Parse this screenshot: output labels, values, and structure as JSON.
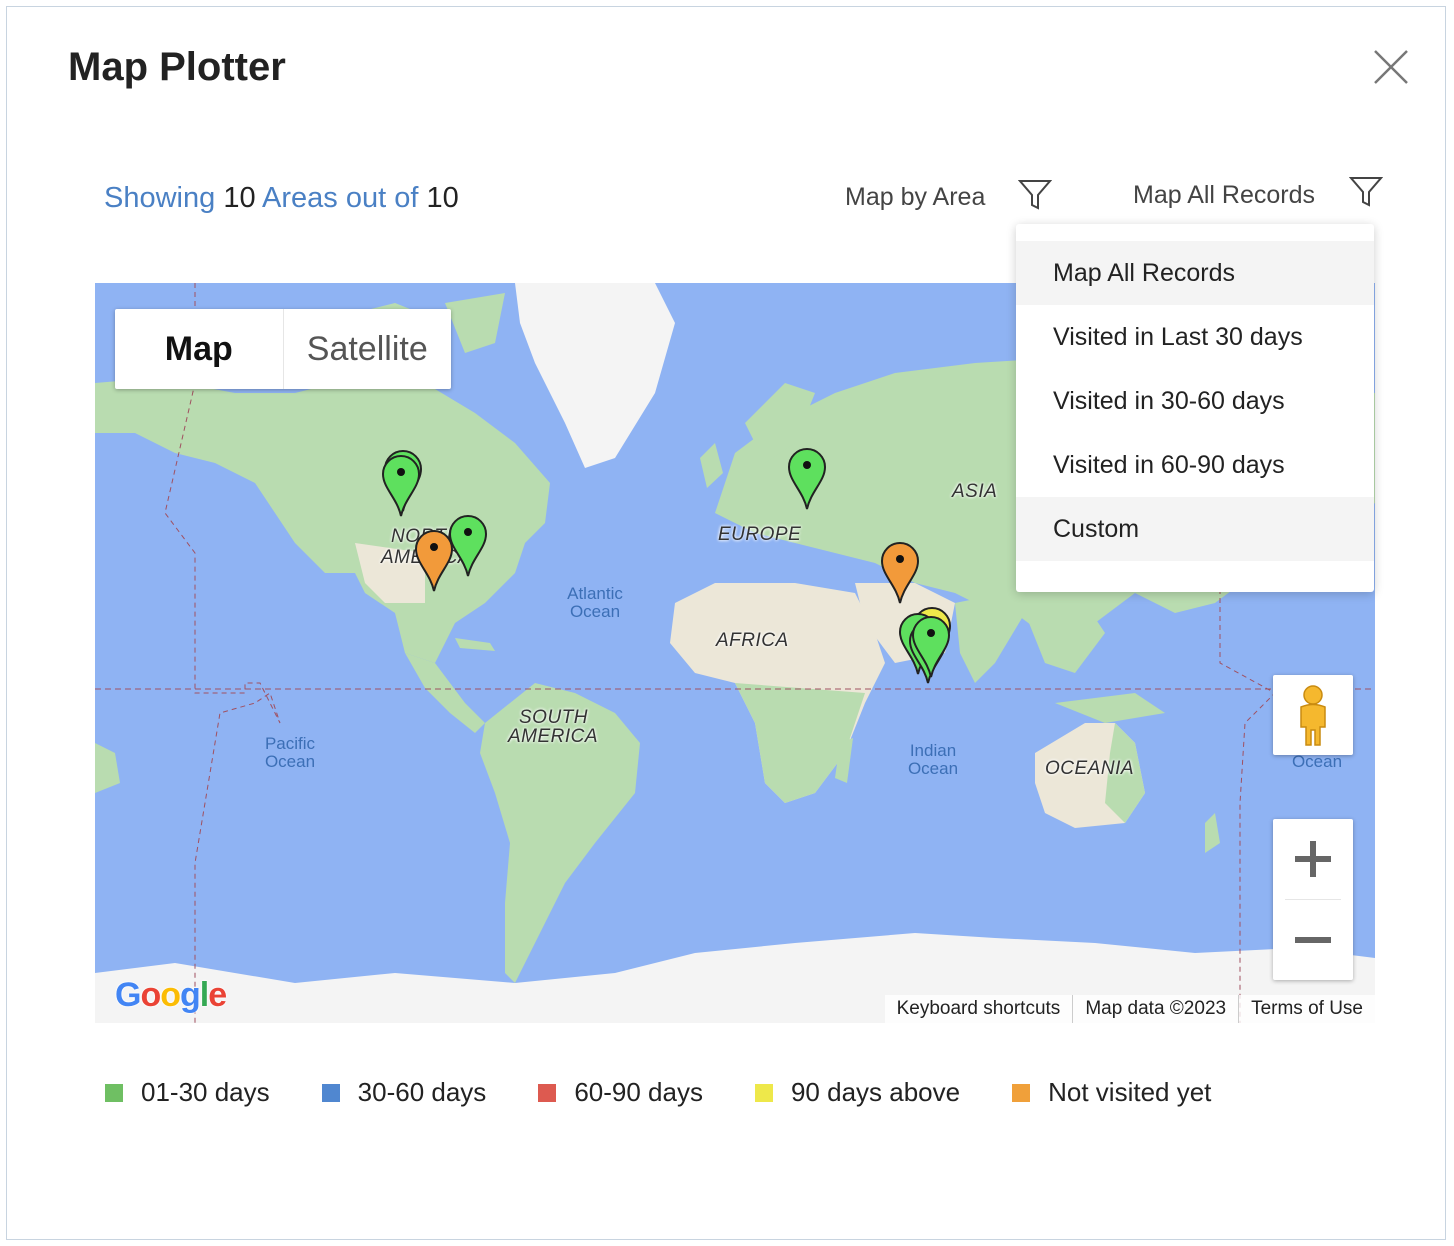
{
  "dialog": {
    "title": "Map Plotter",
    "close_icon": "close-icon"
  },
  "summary": {
    "showing_label": "Showing",
    "shown_count": "10",
    "areas_label": "Areas out of",
    "total_count": "10"
  },
  "filters": {
    "area_label": "Map by Area",
    "records_label": "Map All Records",
    "icon": "filter-funnel-icon"
  },
  "dropdown": {
    "items": [
      {
        "label": "Map All Records",
        "highlighted": true
      },
      {
        "label": "Visited in Last 30 days",
        "highlighted": false
      },
      {
        "label": "Visited in 30-60 days",
        "highlighted": false
      },
      {
        "label": "Visited in 60-90 days",
        "highlighted": false
      },
      {
        "label": "Custom",
        "highlighted": true
      }
    ]
  },
  "map": {
    "type_control": {
      "map_label": "Map",
      "satellite_label": "Satellite",
      "selected": "Map"
    },
    "labels": {
      "north_america_1": "NORTH",
      "north_america_2": "AMERICA",
      "south_america_1": "SOUTH",
      "south_america_2": "AMERICA",
      "europe": "EUROPE",
      "asia": "ASIA",
      "africa": "AFRICA",
      "oceania": "OCEANIA",
      "atlantic": "Atlantic Ocean",
      "pacific": "Pacific Ocean",
      "indian": "Indian Ocean",
      "ocean_right": "Ocean"
    },
    "attribution": {
      "keyboard": "Keyboard shortcuts",
      "map_data": "Map data ©2023",
      "terms": "Terms of Use"
    },
    "logo_text": "Google",
    "colors": {
      "water": "#8fb3f3",
      "land": "#b9dcb0",
      "desert": "#ece7d8",
      "ice": "#f4f4f4"
    }
  },
  "legend": [
    {
      "label": "01-30 days",
      "color": "#6fbf63"
    },
    {
      "label": "30-60 days",
      "color": "#5087d0"
    },
    {
      "label": "60-90 days",
      "color": "#dd5a50"
    },
    {
      "label": "90 days above",
      "color": "#eee84a"
    },
    {
      "label": "Not visited yet",
      "color": "#f0a03a"
    }
  ],
  "markers": [
    {
      "status": "01-30 days",
      "color": "#5ee05e"
    },
    {
      "status": "01-30 days",
      "color": "#5ee05e"
    },
    {
      "status": "01-30 days",
      "color": "#5ee05e"
    },
    {
      "status": "Not visited yet",
      "color": "#f29a3a"
    },
    {
      "status": "01-30 days",
      "color": "#5ee05e"
    },
    {
      "status": "Not visited yet",
      "color": "#f29a3a"
    },
    {
      "status": "90 days above",
      "color": "#eee84a"
    },
    {
      "status": "01-30 days",
      "color": "#5ee05e"
    },
    {
      "status": "01-30 days",
      "color": "#5ee05e"
    },
    {
      "status": "01-30 days",
      "color": "#5ee05e"
    }
  ]
}
